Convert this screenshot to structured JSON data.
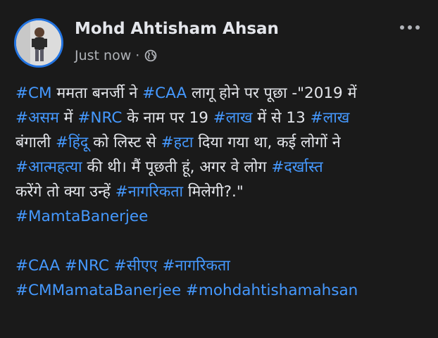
{
  "post": {
    "author": "Mohd Ahtisham Ahsan",
    "time": "Just now",
    "separator": "·",
    "audience_icon": "globe-icon",
    "more_icon": "more-options-icon",
    "body": {
      "line1": {
        "t1": "#CM",
        "t2": " ममता बनर्जी ने ",
        "t3": "#CAA",
        "t4": " लागू होने पर पूछा -\"2019 में"
      },
      "line2": {
        "t1": "#असम",
        "t2": " में ",
        "t3": "#NRC",
        "t4": " के नाम पर 19 ",
        "t5": "#लाख",
        "t6": " में से 13 ",
        "t7": "#लाख"
      },
      "line3": {
        "t1": "बंगाली ",
        "t2": "#हिंदू",
        "t3": " को लिस्ट से ",
        "t4": "#हटा",
        "t5": " दिया गया था, कई लोगों ने"
      },
      "line4": {
        "t1": "#आत्महत्या",
        "t2": " की थी। मैं पूछती हूं, अगर वे लोग ",
        "t3": "#दर्खास्त"
      },
      "line5": {
        "t1": "करेंगे तो क्या उन्हें ",
        "t2": "#नागरिकता",
        "t3": " मिलेगी?.\""
      },
      "line6": {
        "t1": "#MamtaBanerjee"
      },
      "line8": {
        "t1": "#CAA",
        "t2": " ",
        "t3": "#NRC",
        "t4": " ",
        "t5": "#सीएए",
        "t6": " ",
        "t7": "#नागरिकता"
      },
      "line9": {
        "t1": "#CMMamataBanerjee",
        "t2": " ",
        "t3": "#mohdahtishamahsan"
      }
    }
  },
  "colors": {
    "background": "#1a1a1a",
    "text": "#e4e6eb",
    "secondary_text": "#b0b3b8",
    "hashtag": "#4599ff",
    "avatar_ring": "#2374e1"
  }
}
